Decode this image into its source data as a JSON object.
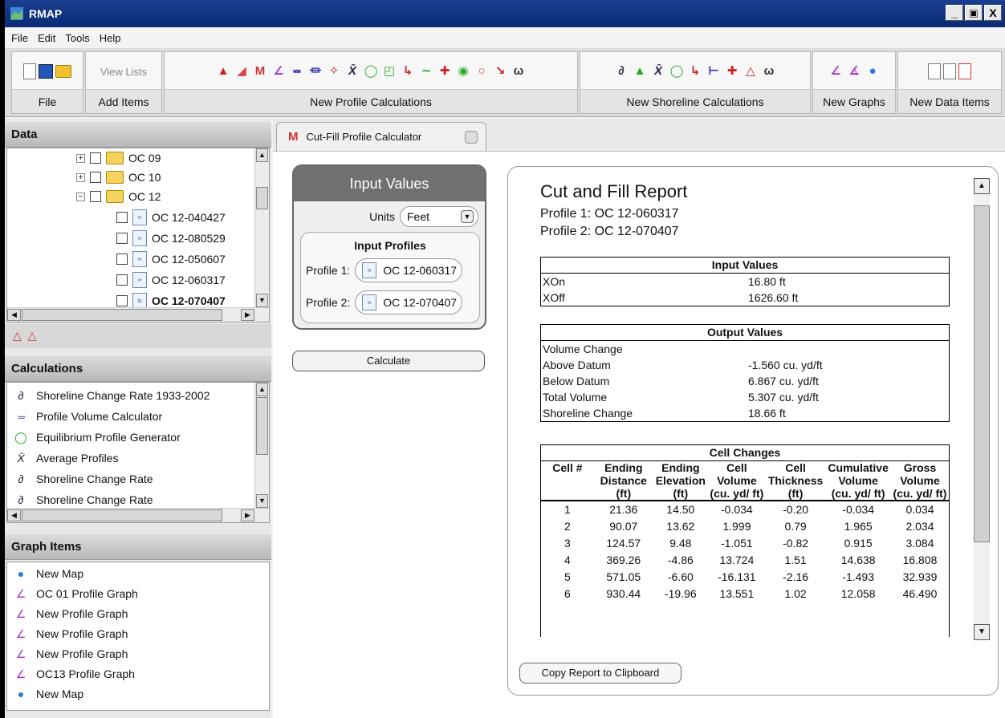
{
  "window": {
    "title": "RMAP",
    "controls": [
      "_",
      "ř",
      "X"
    ]
  },
  "menu": [
    "File",
    "Edit",
    "Tools",
    "Help"
  ],
  "toolbar": {
    "groups": [
      {
        "label": "File"
      },
      {
        "label": "Add Items",
        "view_lists": "View Lists"
      },
      {
        "label": "New Profile Calculations"
      },
      {
        "label": "New Shoreline Calculations"
      },
      {
        "label": "New Graphs"
      },
      {
        "label": "New Data Items"
      }
    ]
  },
  "data_panel": {
    "title": "Data",
    "items": [
      {
        "label": "OC 09",
        "type": "folder",
        "expander": "+"
      },
      {
        "label": "OC 10",
        "type": "folder",
        "expander": "+"
      },
      {
        "label": "OC 12",
        "type": "folder",
        "expander": "−"
      },
      {
        "label": "OC 12-040427",
        "type": "file"
      },
      {
        "label": "OC 12-080529",
        "type": "file"
      },
      {
        "label": "OC 12-050607",
        "type": "file"
      },
      {
        "label": "OC 12-060317",
        "type": "file"
      },
      {
        "label": "OC 12-070407",
        "type": "file",
        "bold": true
      }
    ]
  },
  "calculations_panel": {
    "title": "Calculations",
    "items": [
      {
        "label": "Shoreline Change Rate 1933-2002",
        "icon": "derivative-icon"
      },
      {
        "label": "Profile Volume Calculator",
        "icon": "volume-icon"
      },
      {
        "label": "Equilibrium Profile Generator",
        "icon": "equilibrium-icon"
      },
      {
        "label": "Average Profiles",
        "icon": "average-icon"
      },
      {
        "label": "Shoreline Change Rate",
        "icon": "derivative-icon"
      },
      {
        "label": "Shoreline Change Rate",
        "icon": "derivative-icon"
      }
    ]
  },
  "graph_panel": {
    "title": "Graph Items",
    "items": [
      {
        "label": "New Map",
        "icon": "globe-icon"
      },
      {
        "label": "OC 01 Profile Graph",
        "icon": "graph-icon"
      },
      {
        "label": "New Profile Graph",
        "icon": "graph-icon"
      },
      {
        "label": "New Profile Graph",
        "icon": "graph-icon"
      },
      {
        "label": "New Profile Graph",
        "icon": "graph-icon"
      },
      {
        "label": "OC13 Profile Graph",
        "icon": "graph-icon"
      },
      {
        "label": "New Map",
        "icon": "globe-icon"
      }
    ]
  },
  "tab": {
    "label": "Cut-Fill Profile Calculator"
  },
  "input_values": {
    "title": "Input Values",
    "units_label": "Units",
    "units_value": "Feet",
    "profiles_title": "Input Profiles",
    "profile1_label": "Profile 1:",
    "profile1_value": "OC 12-060317",
    "profile2_label": "Profile 2:",
    "profile2_value": "OC 12-070407",
    "calculate_label": "Calculate"
  },
  "report": {
    "title": "Cut and Fill Report",
    "profile1": "Profile 1: OC 12-060317",
    "profile2": "Profile 2: OC 12-070407",
    "input_values_title": "Input Values",
    "input_values": [
      {
        "key": "XOn",
        "value": "16.80 ft"
      },
      {
        "key": "XOff",
        "value": "1626.60 ft"
      }
    ],
    "output_values_title": "Output Values",
    "output_values": [
      {
        "key": "Volume Change",
        "value": ""
      },
      {
        "key": "Above Datum",
        "value": "-1.560 cu. yd/ft"
      },
      {
        "key": "Below Datum",
        "value": "6.867 cu. yd/ft"
      },
      {
        "key": "Total Volume",
        "value": "5.307 cu. yd/ft"
      },
      {
        "key": "Shoreline Change",
        "value": "18.66 ft"
      }
    ],
    "cell_changes_title": "Cell Changes",
    "cell_headers": [
      "Cell #",
      "Ending Distance (ft)",
      "Ending Elevation (ft)",
      "Cell Volume (cu. yd/ ft)",
      "Cell Thickness (ft)",
      "Cumulative Volume (cu. yd/ ft)",
      "Gross Volume (cu. yd/ ft)"
    ],
    "cell_rows": [
      [
        "1",
        "21.36",
        "14.50",
        "-0.034",
        "-0.20",
        "-0.034",
        "0.034"
      ],
      [
        "2",
        "90.07",
        "13.62",
        "1.999",
        "0.79",
        "1.965",
        "2.034"
      ],
      [
        "3",
        "124.57",
        "9.48",
        "-1.051",
        "-0.82",
        "0.915",
        "3.084"
      ],
      [
        "4",
        "369.26",
        "-4.86",
        "13.724",
        "1.51",
        "14.638",
        "16.808"
      ],
      [
        "5",
        "571.05",
        "-6.60",
        "-16.131",
        "-2.16",
        "-1.493",
        "32.939"
      ],
      [
        "6",
        "930.44",
        "-19.96",
        "13.551",
        "1.02",
        "12.058",
        "46.490"
      ]
    ],
    "copy_label": "Copy Report to Clipboard"
  }
}
